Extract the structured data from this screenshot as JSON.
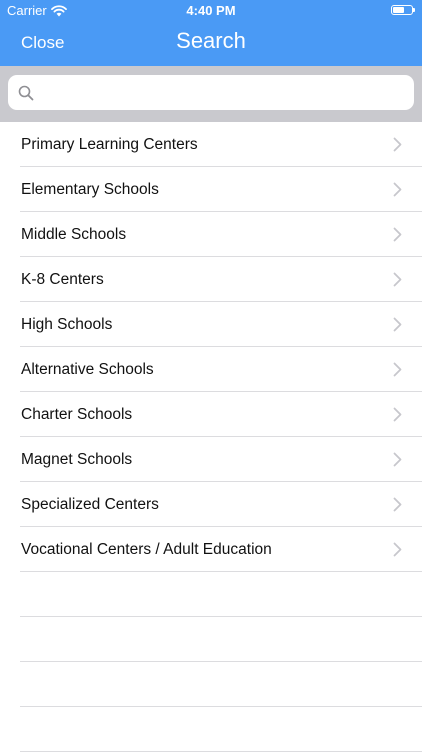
{
  "status_bar": {
    "carrier": "Carrier",
    "time": "4:40 PM",
    "battery_level": 0.6
  },
  "nav": {
    "close_label": "Close",
    "title": "Search"
  },
  "search": {
    "value": "",
    "placeholder": ""
  },
  "icons": {
    "search": "search-icon",
    "chevron": "chevron-right-icon",
    "wifi": "wifi-icon",
    "battery": "battery-icon"
  },
  "colors": {
    "accent": "#4a9af5",
    "search_bar_bg": "#c9c9ce",
    "separator": "#dcdcdf",
    "chevron": "#c7c7cc"
  },
  "categories": [
    {
      "label": "Primary Learning Centers"
    },
    {
      "label": "Elementary Schools"
    },
    {
      "label": "Middle Schools"
    },
    {
      "label": "K-8 Centers"
    },
    {
      "label": "High Schools"
    },
    {
      "label": "Alternative Schools"
    },
    {
      "label": "Charter Schools"
    },
    {
      "label": "Magnet Schools"
    },
    {
      "label": "Specialized Centers"
    },
    {
      "label": "Vocational Centers / Adult Education"
    }
  ]
}
